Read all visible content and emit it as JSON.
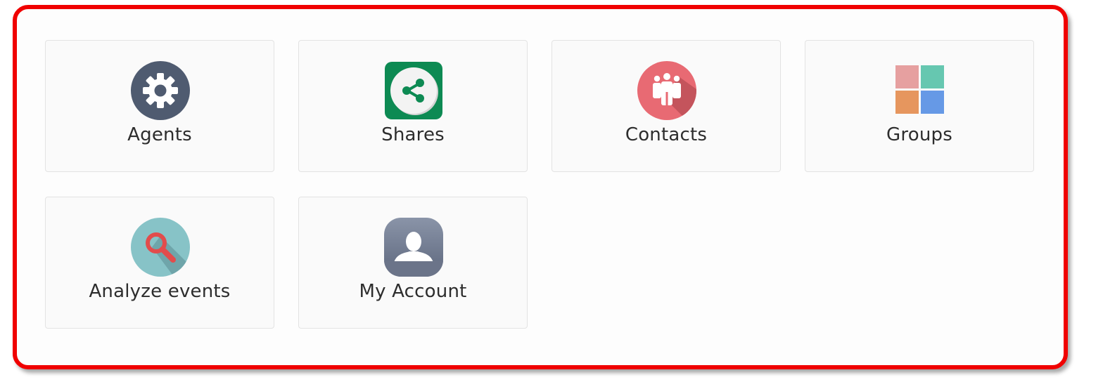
{
  "tiles": [
    {
      "label": "Agents",
      "icon": "gear-icon",
      "color": "#4f5b70"
    },
    {
      "label": "Shares",
      "icon": "share-icon",
      "color": "#0d8a53"
    },
    {
      "label": "Contacts",
      "icon": "contacts-icon",
      "color": "#e86a73"
    },
    {
      "label": "Groups",
      "icon": "groups-grid-icon",
      "colors": [
        "#e6a0a0",
        "#66c7b0",
        "#e6965e",
        "#6699e6"
      ]
    },
    {
      "label": "Analyze events",
      "icon": "magnifier-icon",
      "color": "#87c3c7"
    },
    {
      "label": "My Account",
      "icon": "user-account-icon",
      "color": "#707b91"
    }
  ],
  "frame": {
    "highlight_color": "#f00000"
  }
}
